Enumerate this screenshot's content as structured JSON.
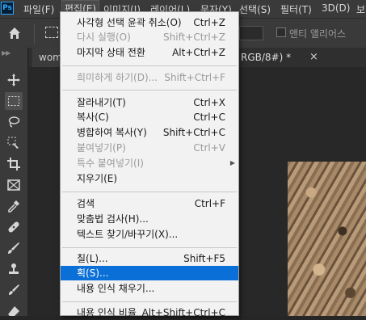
{
  "menubar": {
    "logo": "Ps",
    "items": [
      {
        "label": "파일(F)"
      },
      {
        "label": "편집(E)"
      },
      {
        "label": "이미지(I)"
      },
      {
        "label": "레이어(L)"
      },
      {
        "label": "문자(Y)"
      },
      {
        "label": "선택(S)"
      },
      {
        "label": "필터(T)"
      },
      {
        "label": "3D(D)"
      },
      {
        "label": "보"
      }
    ]
  },
  "options": {
    "antialias_label": "앤티 앨리어스"
  },
  "tabs": [
    {
      "label": "wom"
    },
    {
      "label": "RGB/8#) *"
    }
  ],
  "edit_menu": {
    "items": [
      {
        "label": "사각형 선택 윤곽 취소(O)",
        "shortcut": "Ctrl+Z"
      },
      {
        "label": "다시 실행(O)",
        "shortcut": "Shift+Ctrl+Z"
      },
      {
        "label": "마지막 상태 전환",
        "shortcut": "Alt+Ctrl+Z"
      },
      {
        "label": "희미하게 하기(D)...",
        "shortcut": "Shift+Ctrl+F"
      },
      {
        "label": "잘라내기(T)",
        "shortcut": "Ctrl+X"
      },
      {
        "label": "복사(C)",
        "shortcut": "Ctrl+C"
      },
      {
        "label": "병합하여 복사(Y)",
        "shortcut": "Shift+Ctrl+C"
      },
      {
        "label": "붙여넣기(P)",
        "shortcut": "Ctrl+V"
      },
      {
        "label": "특수 붙여넣기(I)",
        "shortcut": ""
      },
      {
        "label": "지우기(E)",
        "shortcut": ""
      },
      {
        "label": "검색",
        "shortcut": "Ctrl+F"
      },
      {
        "label": "맞춤법 검사(H)...",
        "shortcut": ""
      },
      {
        "label": "텍스트 찾기/바꾸기(X)...",
        "shortcut": ""
      },
      {
        "label": "칠(L)...",
        "shortcut": "Shift+F5"
      },
      {
        "label": "획(S)...",
        "shortcut": ""
      },
      {
        "label": "내용 인식 채우기...",
        "shortcut": ""
      },
      {
        "label": "내용 인식 비율",
        "shortcut": "Alt+Shift+Ctrl+C"
      }
    ]
  },
  "colors": {
    "highlight": "#0a6fd6",
    "menu_bg": "#f2f2f2",
    "app_bg": "#262626"
  }
}
